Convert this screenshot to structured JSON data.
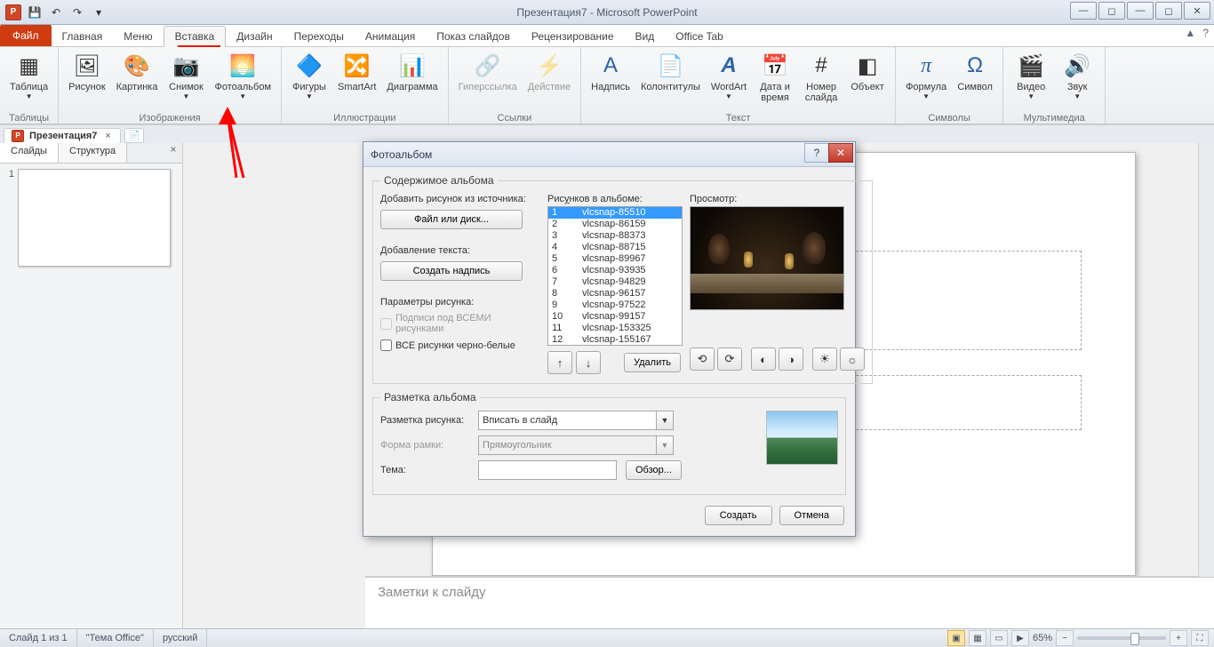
{
  "title": "Презентация7 - Microsoft PowerPoint",
  "qat": {
    "save": "💾",
    "undo": "↶",
    "redo": "↷"
  },
  "win": {
    "min": "—",
    "max": "◻",
    "close": "✕",
    "min2": "—",
    "max2": "◻"
  },
  "tabs": {
    "file": "Файл",
    "home": "Главная",
    "menu": "Меню",
    "insert": "Вставка",
    "design": "Дизайн",
    "transitions": "Переходы",
    "animations": "Анимация",
    "slideshow": "Показ слайдов",
    "review": "Рецензирование",
    "view": "Вид",
    "officetab": "Office Tab"
  },
  "tabhelp": {
    "up": "▲",
    "help": "?"
  },
  "ribbon": {
    "tables": {
      "group": "Таблицы",
      "table": "Таблица"
    },
    "images": {
      "group": "Изображения",
      "picture": "Рисунок",
      "clipart": "Картинка",
      "screenshot": "Снимок",
      "photoalbum": "Фотоальбом"
    },
    "illus": {
      "group": "Иллюстрации",
      "shapes": "Фигуры",
      "smartart": "SmartArt",
      "chart": "Диаграмма"
    },
    "links": {
      "group": "Ссылки",
      "hyper": "Гиперссылка",
      "action": "Действие"
    },
    "text": {
      "group": "Текст",
      "textbox": "Надпись",
      "headerfooter": "Колонтитулы",
      "wordart": "WordArt",
      "datetime": "Дата и\nвремя",
      "slidenum": "Номер\nслайда",
      "object": "Объект"
    },
    "symbols": {
      "group": "Символы",
      "equation": "Формула",
      "symbol": "Символ"
    },
    "media": {
      "group": "Мультимедиа",
      "video": "Видео",
      "audio": "Звук"
    }
  },
  "doctab": {
    "name": "Презентация7",
    "close": "×"
  },
  "leftpane": {
    "slides": "Слайды",
    "outline": "Структура",
    "close": "×",
    "num": "1"
  },
  "notes": "Заметки к слайду",
  "status": {
    "slide": "Слайд 1 из 1",
    "theme": "\"Тема Office\"",
    "lang": "русский",
    "zoom": "65%",
    "plus": "+",
    "minus": "−",
    "fit": "⛶"
  },
  "dialog": {
    "title": "Фотоальбом",
    "help": "?",
    "close": "✕",
    "groupContent": "Содержимое альбома",
    "addFrom": "Добавить рисунок из источника:",
    "fileDisk": "Файл или диск...",
    "addText": "Добавление текста:",
    "newCaption": "Создать надпись",
    "picOptions": "Параметры рисунка:",
    "captionsAll": "Подписи под ВСЕМИ рисунками",
    "allBw": "ВСЕ рисунки черно-белые",
    "picsInAlbum": "Рисунков в альбоме:",
    "preview": "Просмотр:",
    "list": [
      {
        "n": "1",
        "t": "vlcsnap-85510",
        "sel": true
      },
      {
        "n": "2",
        "t": "vlcsnap-86159"
      },
      {
        "n": "3",
        "t": "vlcsnap-88373"
      },
      {
        "n": "4",
        "t": "vlcsnap-88715"
      },
      {
        "n": "5",
        "t": "vlcsnap-89967"
      },
      {
        "n": "6",
        "t": "vlcsnap-93935"
      },
      {
        "n": "7",
        "t": "vlcsnap-94829"
      },
      {
        "n": "8",
        "t": "vlcsnap-96157"
      },
      {
        "n": "9",
        "t": "vlcsnap-97522"
      },
      {
        "n": "10",
        "t": "vlcsnap-99157"
      },
      {
        "n": "11",
        "t": "vlcsnap-153325"
      },
      {
        "n": "12",
        "t": "vlcsnap-155167"
      }
    ],
    "up": "↑",
    "down": "↓",
    "remove": "Удалить",
    "rotL": "⟲",
    "rotR": "⟳",
    "contrastUp": "◐",
    "contrastDn": "◑",
    "brightUp": "☀",
    "brightDn": "☼",
    "groupLayout": "Разметка альбома",
    "picLayout": "Разметка рисунка:",
    "picLayoutVal": "Вписать в слайд",
    "frameShape": "Форма рамки:",
    "frameShapeVal": "Прямоугольник",
    "theme": "Тема:",
    "browse": "Обзор...",
    "create": "Создать",
    "cancel": "Отмена",
    "underlines": {
      "picsU": "у",
      "fileU": "Ф",
      "newU": "н",
      "allU": "Е",
      "bwU": "В",
      "remU": "У",
      "layU": "Р",
      "frU": "р",
      "thU": "Т",
      "brU": "О",
      "crU": "С",
      "caU": "О"
    }
  }
}
